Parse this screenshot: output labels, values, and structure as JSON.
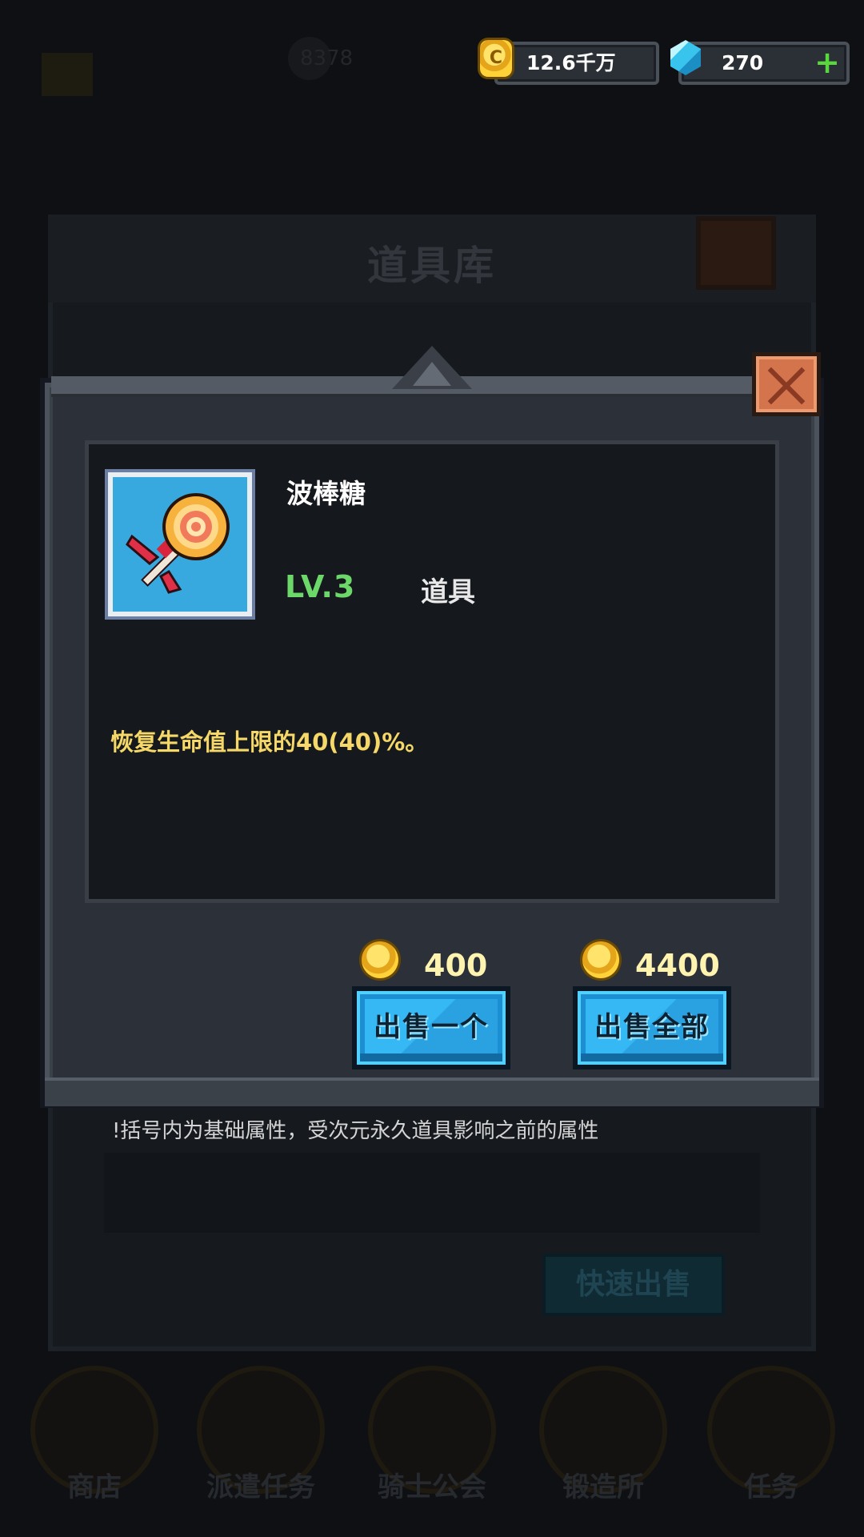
{
  "background": {
    "inventory_title": "道具库",
    "player_power": "8378",
    "quick_sell_label": "快速出售",
    "nav": [
      {
        "label": "商店"
      },
      {
        "label": "派遣任务"
      },
      {
        "label": "骑士公会"
      },
      {
        "label": "锻造所"
      },
      {
        "label": "任务"
      }
    ]
  },
  "currency": {
    "gold": {
      "value": "12.6千万",
      "icon": "gold-coin-icon"
    },
    "gems": {
      "value": "270",
      "icon": "gem-icon",
      "add_label": "+"
    }
  },
  "item_dialog": {
    "name": "波棒糖",
    "level": "LV.3",
    "type": "道具",
    "description": "恢复生命值上限的40(40)%。",
    "icon": "lollipop-icon",
    "sell_one": {
      "price": "400",
      "label": "出售一个"
    },
    "sell_all": {
      "price": "4400",
      "label": "出售全部"
    },
    "footnote": "!括号内为基础属性，受次元永久道具影响之前的属性"
  },
  "colors": {
    "level_green": "#6dd86a",
    "description_yellow": "#f5d867",
    "button_blue": "#2aa2e2",
    "close_orange": "#d4744c"
  }
}
